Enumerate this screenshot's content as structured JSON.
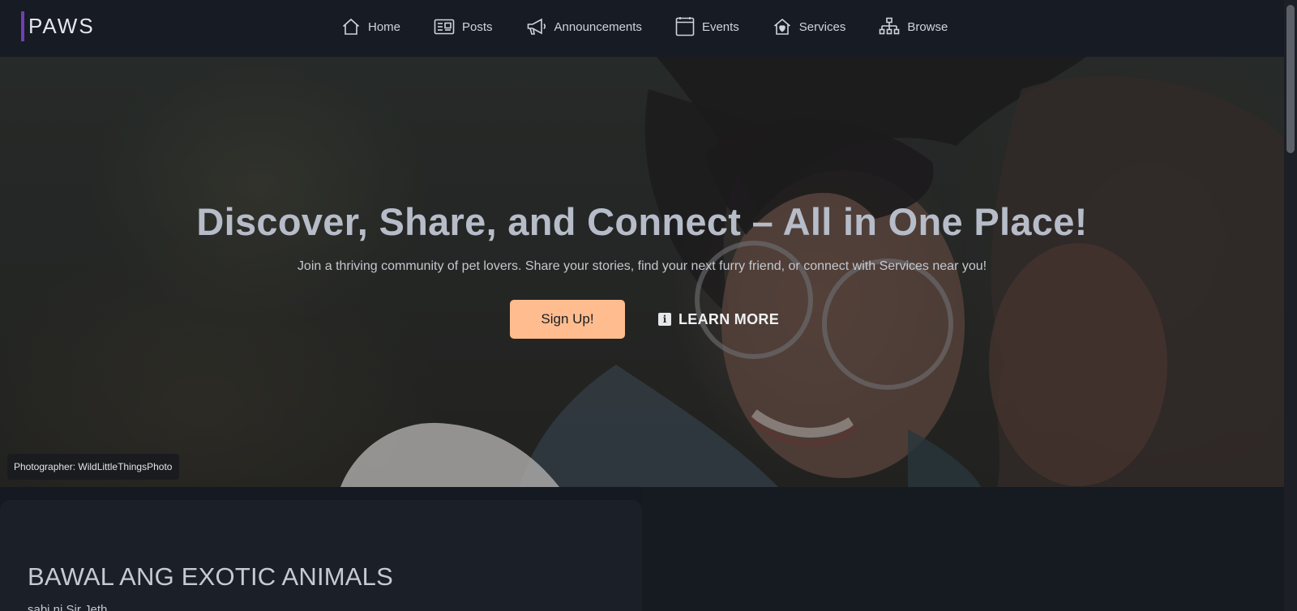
{
  "brand": {
    "name": "PAWS",
    "accent_color": "#6f3fb6"
  },
  "nav": {
    "items": [
      {
        "label": "Home",
        "icon": "home-icon"
      },
      {
        "label": "Posts",
        "icon": "newspaper-icon"
      },
      {
        "label": "Announcements",
        "icon": "megaphone-icon"
      },
      {
        "label": "Events",
        "icon": "calendar-icon"
      },
      {
        "label": "Services",
        "icon": "pet-house-icon"
      },
      {
        "label": "Browse",
        "icon": "sitemap-icon"
      }
    ]
  },
  "hero": {
    "title": "Discover, Share, and Connect – All in One Place!",
    "subtitle": "Join a thriving community of pet lovers. Share your stories, find your next furry friend, or connect with Services near you!",
    "signup_label": "Sign Up!",
    "signup_color": "#ffbd8f",
    "learn_more_label": "LEARN MORE",
    "learn_more_icon": "info-icon",
    "photo_credit": "Photographer: WildLittleThingsPhoto"
  },
  "post": {
    "title": "BAWAL ANG EXOTIC ANIMALS",
    "author": "sabi ni Sir Jeth"
  }
}
